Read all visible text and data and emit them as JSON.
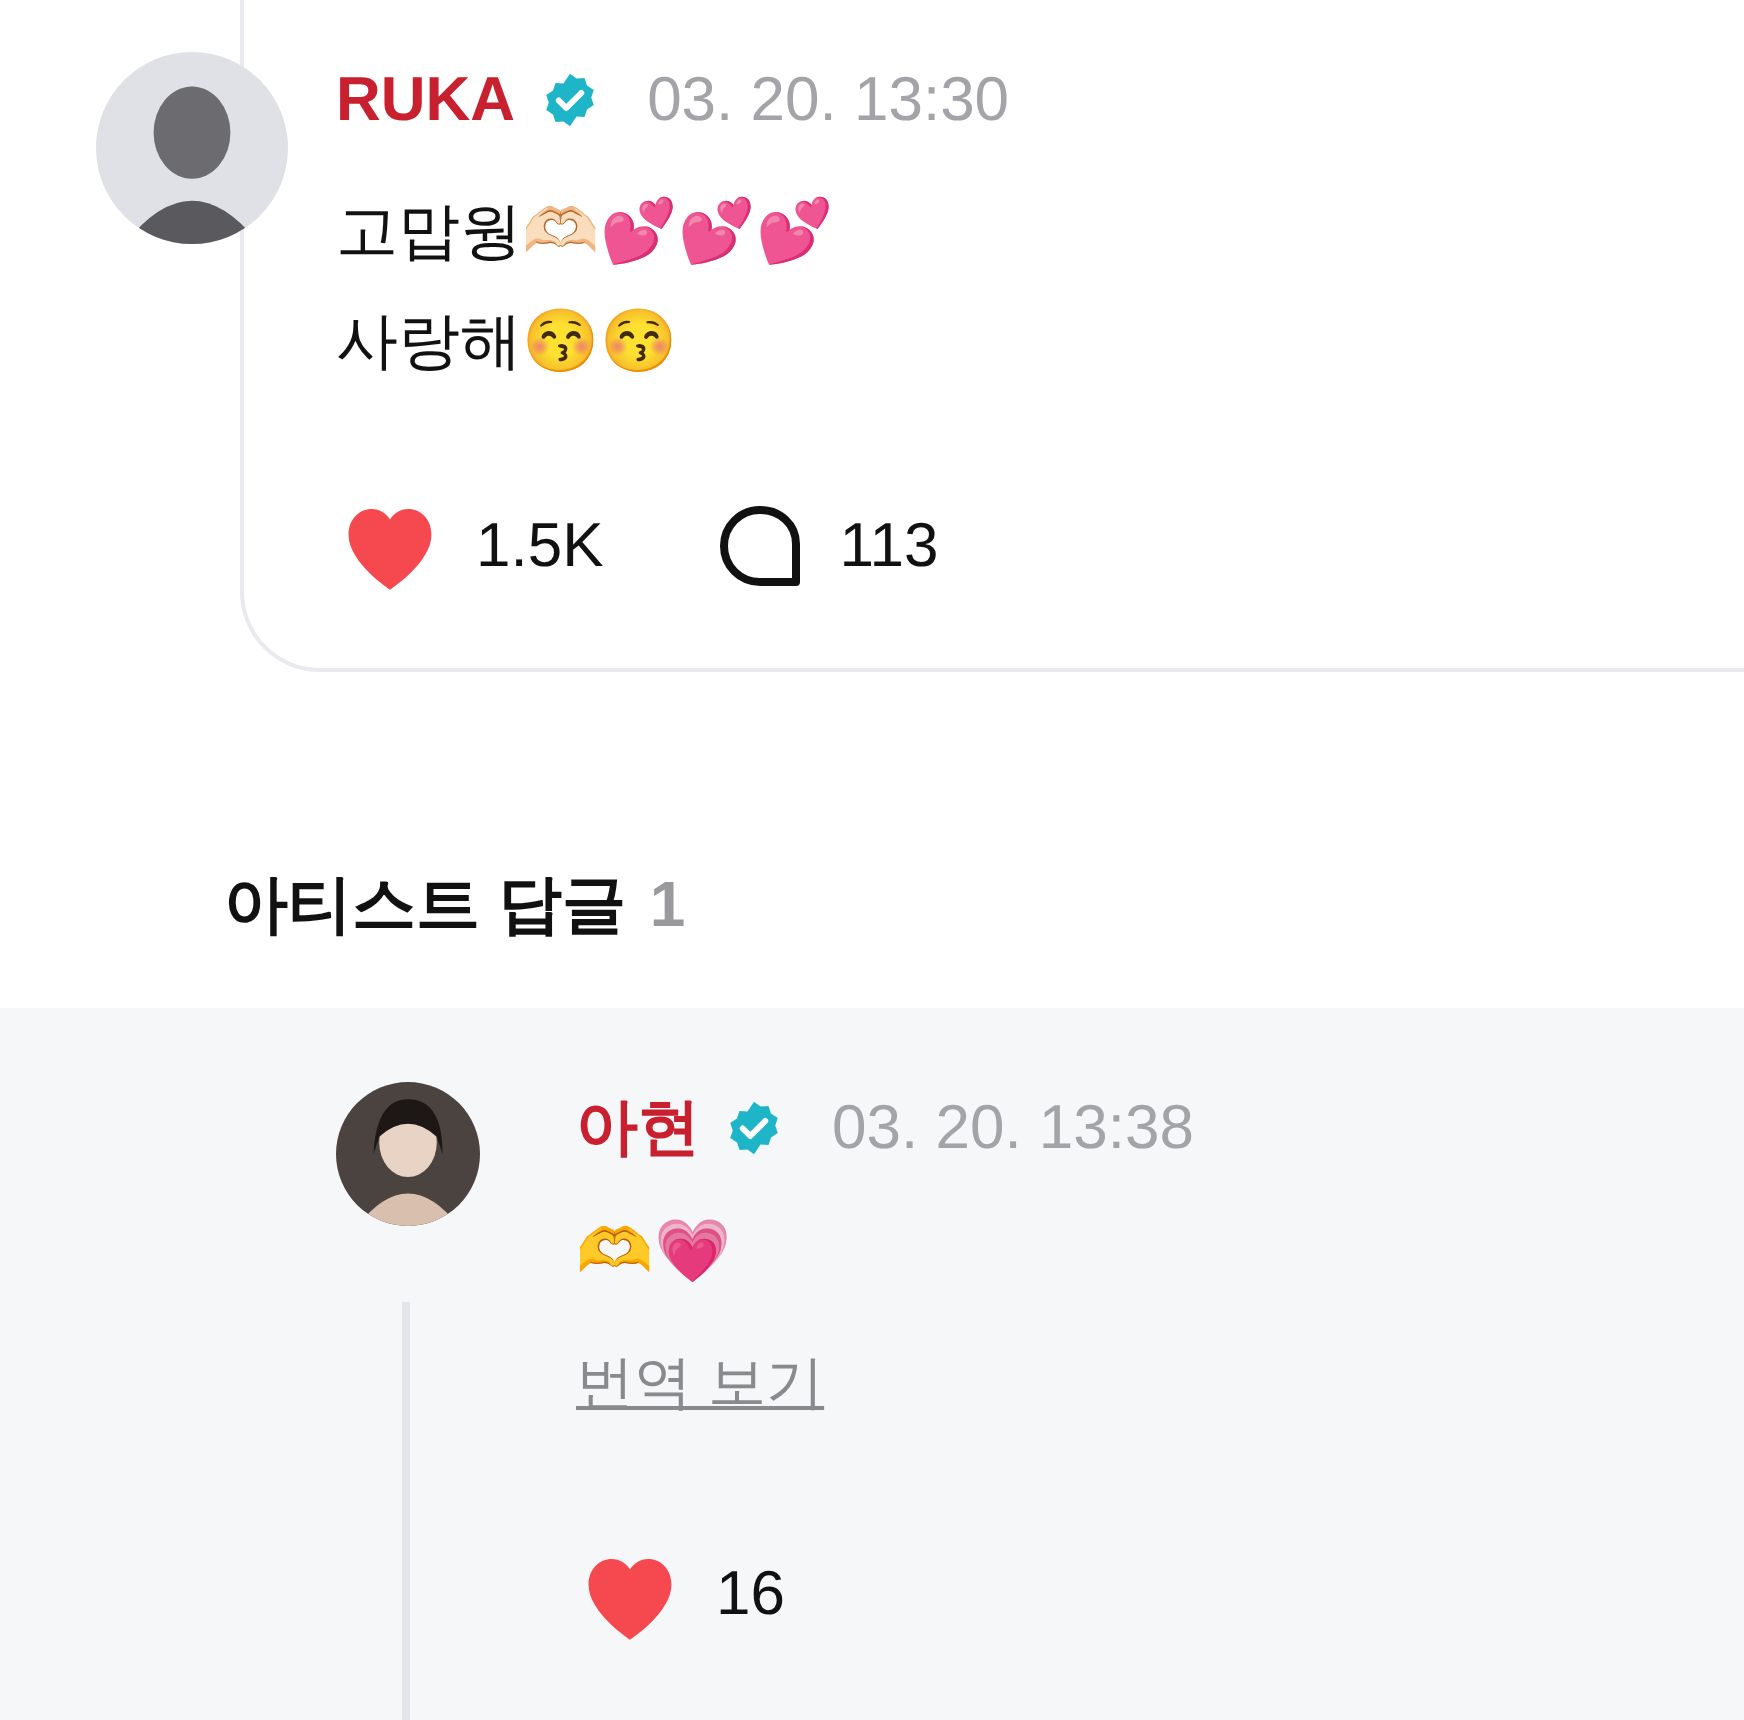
{
  "post": {
    "author": "RUKA",
    "verified": true,
    "time": "03. 20. 13:30",
    "lines": [
      "고맙웡🫶🏻💕💕💕",
      "사랑해😚😚"
    ],
    "liked": true,
    "likes": "1.5K",
    "comments": "113"
  },
  "artist_replies": {
    "title": "아티스트 답글",
    "count": "1",
    "items": [
      {
        "author": "아현",
        "verified": true,
        "time": "03. 20. 13:38",
        "text": "🫶💗",
        "translate_link": "번역 보기",
        "liked": true,
        "likes": "16"
      }
    ]
  }
}
